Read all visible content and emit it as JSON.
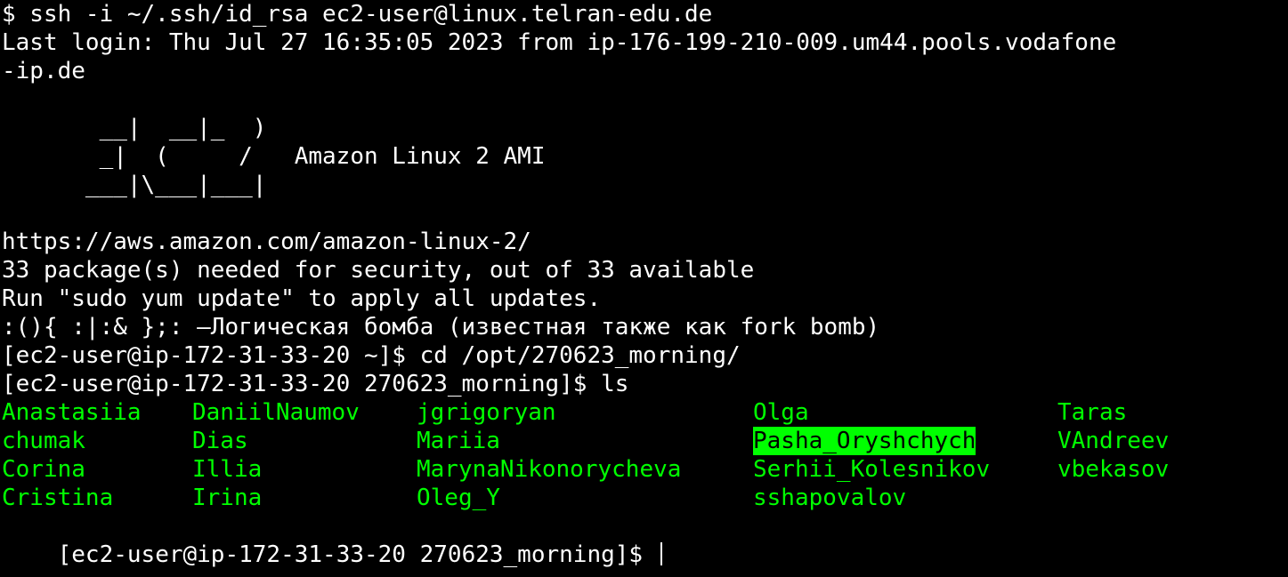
{
  "colors": {
    "background": "#000000",
    "text": "#ffffff",
    "directory_text": "#00ff00",
    "highlight_bg": "#00ff00",
    "highlight_text": "#000000"
  },
  "terminal": {
    "command_ssh": "$ ssh -i ~/.ssh/id_rsa ec2-user@linux.telran-edu.de",
    "last_login_1": "Last login: Thu Jul 27 16:35:05 2023 from ip-176-199-210-009.um44.pools.vodafone",
    "last_login_2": "-ip.de",
    "art_1": "       __|  __|_  )",
    "art_2": "       _|  (     /   Amazon Linux 2 AMI",
    "art_3": "      ___|\\___|___|",
    "url": "https://aws.amazon.com/amazon-linux-2/",
    "packages": "33 package(s) needed for security, out of 33 available",
    "run_update": "Run \"sudo yum update\" to apply all updates.",
    "fork_bomb": ":(){ :|:& };: —Логическая бомба (известная также как fork bomb)",
    "prompt_cd": "[ec2-user@ip-172-31-33-20 ~]$ cd /opt/270623_morning/",
    "prompt_ls": "[ec2-user@ip-172-31-33-20 270623_morning]$ ls",
    "prompt_final": "[ec2-user@ip-172-31-33-20 270623_morning]$ "
  },
  "ls_rows": [
    [
      "Anastasiia",
      "DaniilNaumov",
      "jgrigoryan",
      "Olga",
      "Taras"
    ],
    [
      "chumak",
      "Dias",
      "Mariia",
      "Pasha_Oryshchych",
      "VAndreev"
    ],
    [
      "Corina",
      "Illia",
      "MarynaNikonorycheva",
      "Serhii_Kolesnikov",
      "vbekasov"
    ],
    [
      "Cristina",
      "Irina",
      "Oleg_Y",
      "sshapovalov",
      ""
    ]
  ]
}
